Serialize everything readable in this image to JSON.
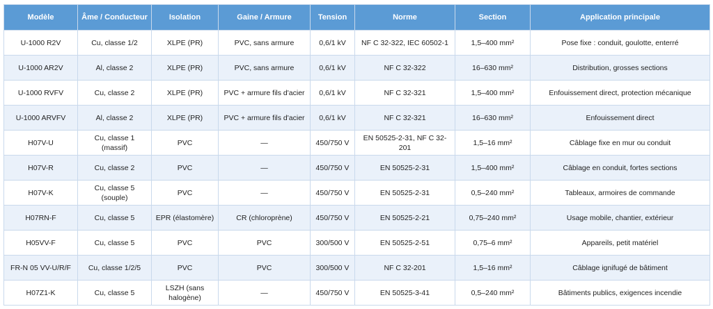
{
  "headers": [
    "Modèle",
    "Âme / Conducteur",
    "Isolation",
    "Gaine / Armure",
    "Tension",
    "Norme",
    "Section",
    "Application principale"
  ],
  "rows": [
    [
      "U-1000 R2V",
      "Cu, classe 1/2",
      "XLPE (PR)",
      "PVC, sans armure",
      "0,6/1 kV",
      "NF C 32-322, IEC 60502-1",
      "1,5–400 mm²",
      "Pose fixe : conduit, goulotte, enterré"
    ],
    [
      "U-1000 AR2V",
      "Al, classe 2",
      "XLPE (PR)",
      "PVC, sans armure",
      "0,6/1 kV",
      "NF C 32-322",
      "16–630 mm²",
      "Distribution, grosses sections"
    ],
    [
      "U-1000 RVFV",
      "Cu, classe 2",
      "XLPE (PR)",
      "PVC + armure fils d'acier",
      "0,6/1 kV",
      "NF C 32-321",
      "1,5–400 mm²",
      "Enfouissement direct, protection mécanique"
    ],
    [
      "U-1000 ARVFV",
      "Al, classe 2",
      "XLPE (PR)",
      "PVC + armure fils d'acier",
      "0,6/1 kV",
      "NF C 32-321",
      "16–630 mm²",
      "Enfouissement direct"
    ],
    [
      "H07V-U",
      "Cu, classe 1 (massif)",
      "PVC",
      "—",
      "450/750 V",
      "EN 50525-2-31, NF C 32-201",
      "1,5–16 mm²",
      "Câblage fixe en mur ou conduit"
    ],
    [
      "H07V-R",
      "Cu, classe 2",
      "PVC",
      "—",
      "450/750 V",
      "EN 50525-2-31",
      "1,5–400 mm²",
      "Câblage en conduit, fortes sections"
    ],
    [
      "H07V-K",
      "Cu, classe 5 (souple)",
      "PVC",
      "—",
      "450/750 V",
      "EN 50525-2-31",
      "0,5–240 mm²",
      "Tableaux, armoires de commande"
    ],
    [
      "H07RN-F",
      "Cu, classe 5",
      "EPR (élastomère)",
      "CR (chloroprène)",
      "450/750 V",
      "EN 50525-2-21",
      "0,75–240 mm²",
      "Usage mobile, chantier, extérieur"
    ],
    [
      "H05VV-F",
      "Cu, classe 5",
      "PVC",
      "PVC",
      "300/500 V",
      "EN 50525-2-51",
      "0,75–6 mm²",
      "Appareils, petit matériel"
    ],
    [
      "FR-N 05 VV-U/R/F",
      "Cu, classe 1/2/5",
      "PVC",
      "PVC",
      "300/500 V",
      "NF C 32-201",
      "1,5–16 mm²",
      "Câblage ignifugé de bâtiment"
    ],
    [
      "H07Z1-K",
      "Cu, classe 5",
      "LSZH (sans halogène)",
      "—",
      "450/750 V",
      "EN 50525-3-41",
      "0,5–240 mm²",
      "Bâtiments publics, exigences incendie"
    ]
  ]
}
